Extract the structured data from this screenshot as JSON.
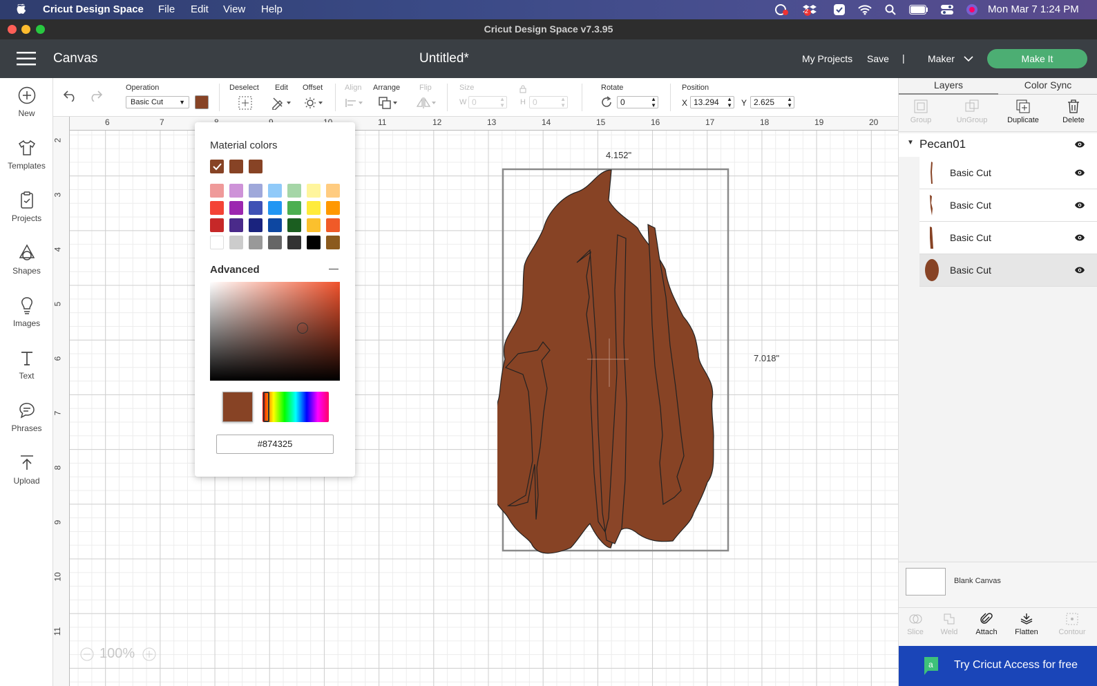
{
  "menubar": {
    "app_name": "Cricut Design Space",
    "menus": [
      "File",
      "Edit",
      "View",
      "Help"
    ],
    "clock": "Mon Mar 7  1:24 PM",
    "dropbox_badge": "2"
  },
  "window": {
    "title": "Cricut Design Space  v7.3.95"
  },
  "header": {
    "canvas_label": "Canvas",
    "doc_title": "Untitled*",
    "my_projects": "My Projects",
    "save": "Save",
    "divider": "|",
    "machine": "Maker",
    "make_it": "Make It"
  },
  "sidebar": {
    "items": [
      {
        "label": "New",
        "icon": "plus-circle-icon"
      },
      {
        "label": "Templates",
        "icon": "shirt-icon"
      },
      {
        "label": "Projects",
        "icon": "clipboard-icon"
      },
      {
        "label": "Shapes",
        "icon": "shapes-icon"
      },
      {
        "label": "Images",
        "icon": "lightbulb-icon"
      },
      {
        "label": "Text",
        "icon": "text-icon"
      },
      {
        "label": "Phrases",
        "icon": "speech-bubble-icon"
      },
      {
        "label": "Upload",
        "icon": "upload-icon"
      }
    ]
  },
  "toolbar": {
    "operation_label": "Operation",
    "operation_value": "Basic Cut",
    "operation_color": "#874325",
    "deselect": "Deselect",
    "edit": "Edit",
    "offset": "Offset",
    "align": "Align",
    "arrange": "Arrange",
    "flip": "Flip",
    "size": "Size",
    "w_label": "W",
    "w_value": "0",
    "h_label": "H",
    "h_value": "0",
    "rotate": "Rotate",
    "rotate_value": "0",
    "position": "Position",
    "x_label": "X",
    "x_value": "13.294",
    "y_label": "Y",
    "y_value": "2.625"
  },
  "rulers": {
    "horizontal": [
      "6",
      "7",
      "8",
      "9",
      "10",
      "11",
      "12",
      "13",
      "14",
      "15",
      "16",
      "17",
      "18",
      "19",
      "20"
    ],
    "vertical": [
      "2",
      "3",
      "4",
      "5",
      "6",
      "7",
      "8",
      "9",
      "10",
      "11"
    ]
  },
  "canvas": {
    "width_dim": "4.152\"",
    "height_dim": "7.018\"",
    "zoom": "100%",
    "shape_color": "#874325"
  },
  "color_popup": {
    "material_title": "Material colors",
    "material_swatches": [
      "#874325",
      "#874325",
      "#874325"
    ],
    "palette": [
      [
        "#ef9a9a",
        "#ce93d8",
        "#9fa8da",
        "#90caf9",
        "#a5d6a7",
        "#fff59d",
        "#ffcc80"
      ],
      [
        "#f44336",
        "#9c27b0",
        "#3f51b5",
        "#2196f3",
        "#4caf50",
        "#ffeb3b",
        "#ff9800"
      ],
      [
        "#c62828",
        "#4a2a8a",
        "#1a237e",
        "#0d47a1",
        "#1b5e20",
        "#fbc02d",
        "#f05a28"
      ],
      [
        "#ffffff",
        "#cccccc",
        "#999999",
        "#666666",
        "#333333",
        "#000000",
        "#8b5a1e"
      ]
    ],
    "advanced_title": "Advanced",
    "collapse": "—",
    "hex_value": "#874325"
  },
  "right_panel": {
    "tabs": [
      "Layers",
      "Color Sync"
    ],
    "actions": [
      {
        "label": "Group",
        "icon": "group-icon",
        "enabled": false
      },
      {
        "label": "UnGroup",
        "icon": "ungroup-icon",
        "enabled": false
      },
      {
        "label": "Duplicate",
        "icon": "duplicate-icon",
        "enabled": true
      },
      {
        "label": "Delete",
        "icon": "trash-icon",
        "enabled": true
      }
    ],
    "group_name": "Pecan01",
    "layers": [
      {
        "name": "Basic Cut"
      },
      {
        "name": "Basic Cut"
      },
      {
        "name": "Basic Cut"
      },
      {
        "name": "Basic Cut"
      }
    ],
    "blank_canvas": "Blank Canvas",
    "bottom_actions": [
      {
        "label": "Slice",
        "icon": "slice-icon",
        "enabled": false
      },
      {
        "label": "Weld",
        "icon": "weld-icon",
        "enabled": false
      },
      {
        "label": "Attach",
        "icon": "paperclip-icon",
        "enabled": true
      },
      {
        "label": "Flatten",
        "icon": "flatten-icon",
        "enabled": true
      },
      {
        "label": "Contour",
        "icon": "contour-icon",
        "enabled": false
      }
    ],
    "access_banner": "Try Cricut Access for free"
  }
}
